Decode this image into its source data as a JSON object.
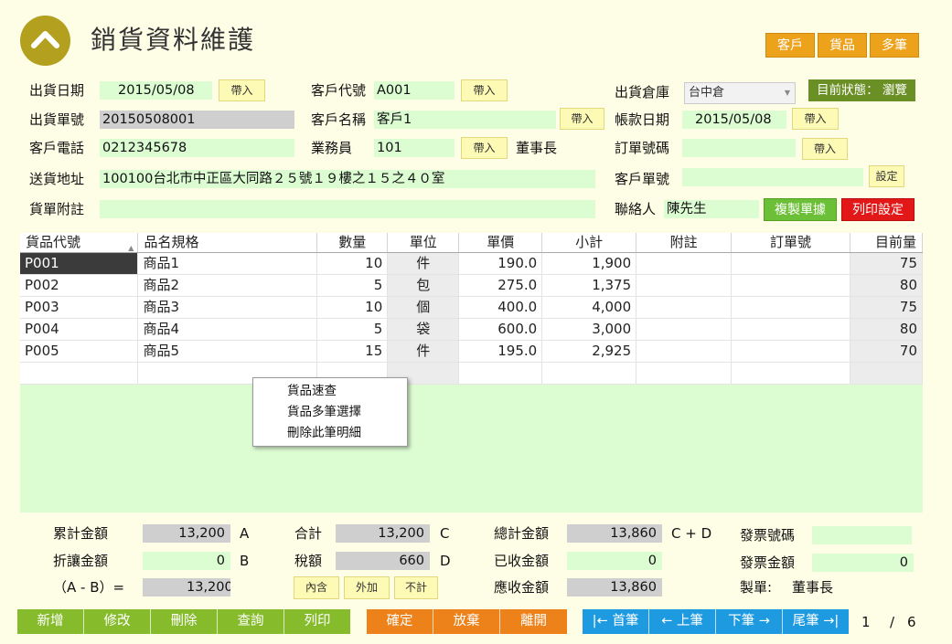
{
  "title": "銷貨資料維護",
  "top_buttons": [
    "客戶",
    "貨品",
    "多筆"
  ],
  "status": "目前狀態： 瀏覽",
  "form": {
    "ship_date_label": "出貨日期",
    "ship_date": "2015/05/08",
    "ship_no_label": "出貨單號",
    "ship_no": "20150508001",
    "phone_label": "客戶電話",
    "phone": "0212345678",
    "address_label": "送貨地址",
    "address": "100100台北市中正區大同路２５號１９樓之１５之４０室",
    "note_label": "貨單附註",
    "note": "",
    "cust_code_label": "客戶代號",
    "cust_code": "A001",
    "cust_name_label": "客戶名稱",
    "cust_name": "客戶1",
    "sales_label": "業務員",
    "sales_code": "101",
    "sales_name": "董事長",
    "warehouse_label": "出貨倉庫",
    "warehouse": "台中倉",
    "account_date_label": "帳款日期",
    "account_date": "2015/05/08",
    "order_no_label": "訂單號碼",
    "order_no": "",
    "cust_order_label": "客戶單號",
    "cust_order": "",
    "contact_label": "聯絡人",
    "contact": "陳先生",
    "import_label": "帶入",
    "setting_label": "設定",
    "copy_label": "複製單據",
    "print_setting_label": "列印設定"
  },
  "grid": {
    "headers": [
      "貨品代號",
      "品名規格",
      "數量",
      "單位",
      "單價",
      "小計",
      "附註",
      "訂單號",
      "目前量"
    ],
    "rows": [
      {
        "code": "P001",
        "name": "商品1",
        "qty": "10",
        "unit": "件",
        "price": "190.0",
        "subtotal": "1,900",
        "note": "",
        "order": "",
        "stock": "75"
      },
      {
        "code": "P002",
        "name": "商品2",
        "qty": "5",
        "unit": "包",
        "price": "275.0",
        "subtotal": "1,375",
        "note": "",
        "order": "",
        "stock": "80"
      },
      {
        "code": "P003",
        "name": "商品3",
        "qty": "10",
        "unit": "個",
        "price": "400.0",
        "subtotal": "4,000",
        "note": "",
        "order": "",
        "stock": "75"
      },
      {
        "code": "P004",
        "name": "商品4",
        "qty": "5",
        "unit": "袋",
        "price": "600.0",
        "subtotal": "3,000",
        "note": "",
        "order": "",
        "stock": "80"
      },
      {
        "code": "P005",
        "name": "商品5",
        "qty": "15",
        "unit": "件",
        "price": "195.0",
        "subtotal": "2,925",
        "note": "",
        "order": "",
        "stock": "70"
      }
    ]
  },
  "context_menu": [
    "貨品速查",
    "貨品多筆選擇",
    "刪除此筆明細"
  ],
  "totals": {
    "cum_label": "累計金額",
    "cum_value": "13,200",
    "cum_suffix": "A",
    "discount_label": "折讓金額",
    "discount_value": "0",
    "discount_suffix": "B",
    "ab_label": "（A - B）=",
    "ab_value": "13,200",
    "sum_label": "合計",
    "sum_value": "13,200",
    "sum_suffix": "C",
    "tax_label": "稅額",
    "tax_value": "660",
    "tax_suffix": "D",
    "tax_opts": [
      "內含",
      "外加",
      "不計"
    ],
    "total_label": "總計金額",
    "total_value": "13,860",
    "total_suffix": "C + D",
    "received_label": "已收金額",
    "received_value": "0",
    "receivable_label": "應收金額",
    "receivable_value": "13,860",
    "invoice_no_label": "發票號碼",
    "invoice_no": "",
    "invoice_amt_label": "發票金額",
    "invoice_amt": "0",
    "maker_label": "製單:",
    "maker": "董事長"
  },
  "actions": [
    "新增",
    "修改",
    "刪除",
    "查詢",
    "列印"
  ],
  "confirm_actions": [
    "確定",
    "放棄",
    "離開"
  ],
  "nav_actions": [
    "|← 首筆",
    "← 上筆",
    "下筆 →",
    "尾筆 →|"
  ],
  "pager": {
    "current": "1",
    "sep": "/",
    "total": "6"
  },
  "colors": {
    "green_field": "#dcfcd2",
    "orange": "#ed821a",
    "blue": "#1e9ae1",
    "action_green": "#86bb2c",
    "logo": "#b3a01e"
  },
  "icons": {
    "logo": "chevron-up-icon",
    "sort": "sort-asc-icon",
    "dropdown": "chevron-down-icon"
  }
}
